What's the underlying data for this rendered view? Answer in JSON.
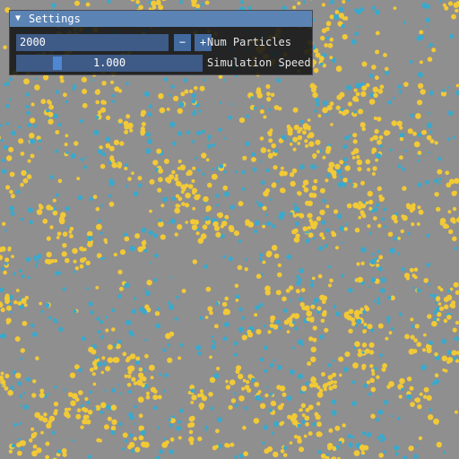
{
  "scene": {
    "background_color": "#8f8f8f",
    "particle_colors": {
      "yellow": "#f2c936",
      "blue": "#3aa9cc"
    }
  },
  "panel": {
    "title": "Settings",
    "collapse_icon": "triangle-down-icon",
    "num_particles": {
      "value": "2000",
      "label": "Num Particles",
      "minus_label": "−",
      "plus_label": "+"
    },
    "simulation_speed": {
      "value": "1.000",
      "label": "Simulation Speed",
      "fraction": 0.2
    }
  }
}
